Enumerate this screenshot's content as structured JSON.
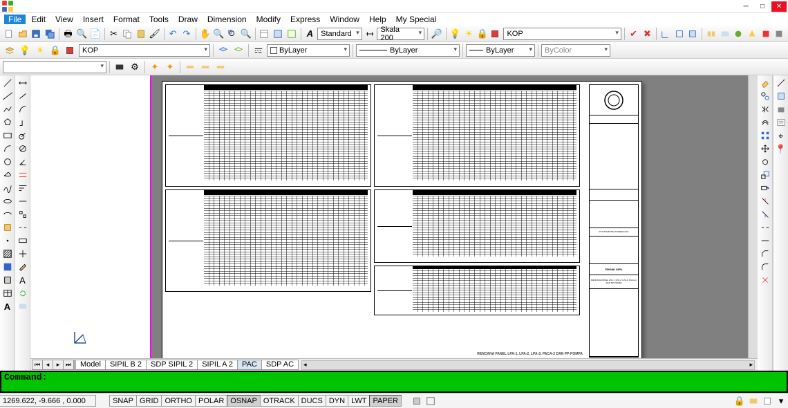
{
  "menubar": [
    "File",
    "Edit",
    "View",
    "Insert",
    "Format",
    "Tools",
    "Draw",
    "Dimension",
    "Modify",
    "Express",
    "Window",
    "Help",
    "My Special"
  ],
  "toolbar1": {
    "style_combo": "Standard",
    "scale_combo": "Skala 200",
    "layer_combo2": "KOP"
  },
  "toolbar2": {
    "layer_combo": "KOP",
    "linetype": "ByLayer",
    "lineweight_label": "ByLayer",
    "plotstyle": "ByLayer",
    "bycolor": "ByColor"
  },
  "tabs": [
    "Model",
    "SIPIL B 2",
    "SDP SIPIL 2",
    "SIPIL A 2",
    "PAC",
    "SDP AC"
  ],
  "active_tab": 4,
  "sheet_title": "RENCANA PANEL LPA-1, LPA-2, LPA-3, PACA-2 DAN PP-POMPA",
  "command_prompt": "Command:",
  "status": {
    "coords": "1269.622, -9.666 , 0.000",
    "toggles": [
      "SNAP",
      "GRID",
      "ORTHO",
      "POLAR",
      "OSNAP",
      "OTRACK",
      "DUCS",
      "DYN",
      "LWT",
      "PAPER"
    ],
    "pressed": [
      "OSNAP",
      "PAPER"
    ]
  },
  "titleblock_company": "PT.CITRAMITRA TRIRENCANA",
  "titleblock_dept": "TEKNIK SIPIL",
  "titleblock_sheet": "RENCANA PANEL LPA-1, LPA-2, LPA-3, PACA-2 DAN PP-POMPA"
}
